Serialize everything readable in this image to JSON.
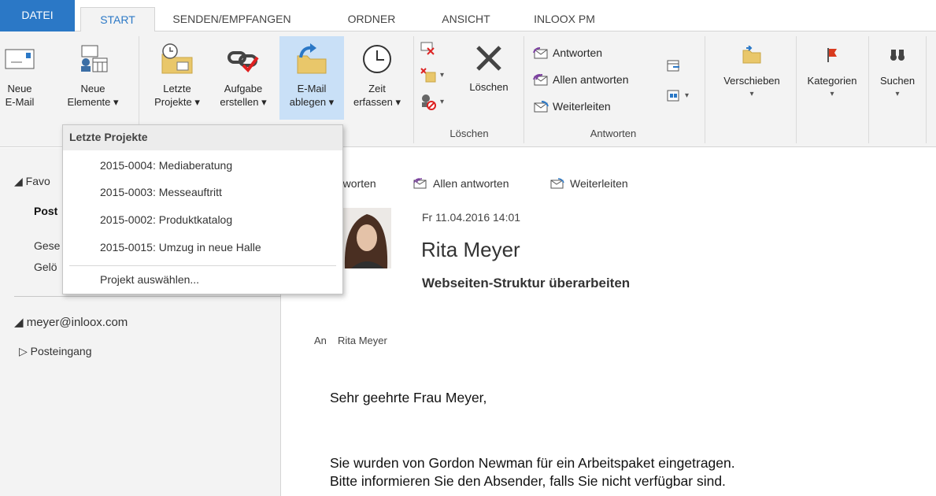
{
  "tabs": [
    "DATEI",
    "START",
    "SENDEN/EMPFANGEN",
    "ORDNER",
    "ANSICHT",
    "INLOOX PM"
  ],
  "ribbon": {
    "new_email": [
      "Neue",
      "E-Mail"
    ],
    "new_items": [
      "Neue",
      "Elemente ▾"
    ],
    "recent_projects": [
      "Letzte",
      "Projekte ▾"
    ],
    "create_task": [
      "Aufgabe",
      "erstellen ▾"
    ],
    "file_email": [
      "E-Mail",
      "ablegen ▾"
    ],
    "track_time": [
      "Zeit",
      "erfassen ▾"
    ],
    "delete": "Löschen",
    "delete_group": "Löschen",
    "reply": "Antworten",
    "reply_all": "Allen antworten",
    "forward": "Weiterleiten",
    "respond_group": "Antworten",
    "move": "Verschieben",
    "categorize": "Kategorien",
    "search": "Suchen",
    "dropdown_caret": "▾"
  },
  "leftpane": {
    "favorites": "◢ Favo",
    "inbox": "Post",
    "sent": "Gese",
    "deleted": "Gelö",
    "account": "◢ meyer@inloox.com",
    "account_inbox": "▷ Posteingang"
  },
  "reading": {
    "reply": "ntworten",
    "reply_all": "Allen antworten",
    "forward": "Weiterleiten",
    "date": "Fr 11.04.2016 14:01",
    "sender": "Rita Meyer",
    "subject": "Webseiten-Struktur überarbeiten",
    "to_label": "An",
    "to_value": "Rita Meyer",
    "greeting": "Sehr geehrte Frau Meyer,",
    "line1": "Sie wurden von Gordon Newman für ein Arbeitspaket eingetragen.",
    "line2": "Bitte informieren Sie den Absender, falls Sie nicht verfügbar sind."
  },
  "dropdown": {
    "header": "Letzte Projekte",
    "items": [
      "2015-0004: Mediaberatung",
      "2015-0003:  Messeauftritt",
      "2015-0002: Produktkatalog",
      "2015-0015: Umzug in neue Halle"
    ],
    "select_project": "Projekt auswählen..."
  },
  "colors": {
    "accent": "#2b78c6",
    "highlight": "#c9e0f7",
    "ribbon_bg": "#f3f3f3"
  }
}
